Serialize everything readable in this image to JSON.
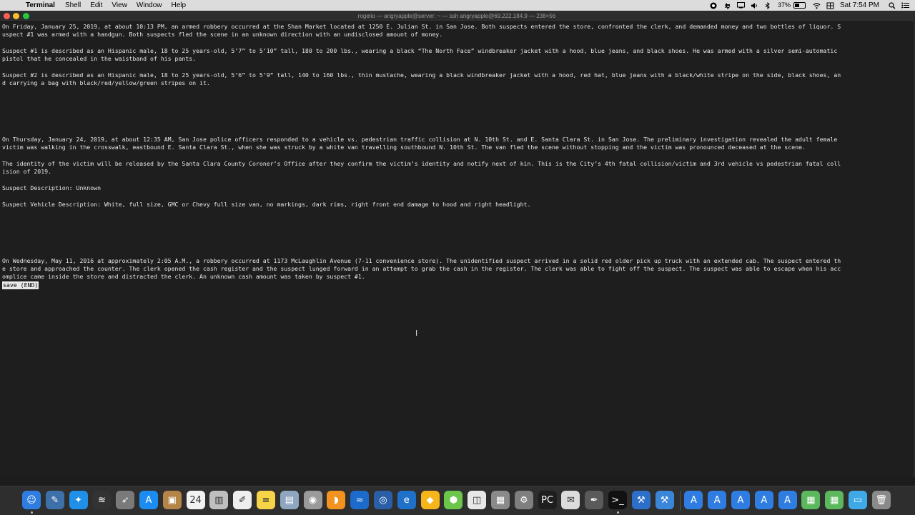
{
  "menubar": {
    "apple_glyph": "",
    "items": [
      "Terminal",
      "Shell",
      "Edit",
      "View",
      "Window",
      "Help"
    ],
    "battery_text": "37%",
    "clock": "Sat 7:54 PM"
  },
  "window": {
    "title": "rogelio — angryapple@server: ~ — ssh angryapple@69.222.184.9 — 238×56"
  },
  "terminal": {
    "lines": [
      "On Friday, January 25, 2019, at about 10:13 PM, an armed robbery occurred at the Shan Market located at 1250 E. Julian St. in San Jose. Both suspects entered the store, confronted the clerk, and demanded money and two bottles of liquor. S",
      "uspect #1 was armed with a handgun. Both suspects fled the scene in an unknown direction with an undisclosed amount of money.",
      "",
      "Suspect #1 is described as an Hispanic male, 18 to 25 years-old, 5’7” to 5’10” tall, 180 to 200 lbs., wearing a black “The North Face” windbreaker jacket with a hood, blue jeans, and black shoes. He was armed with a silver semi-automatic",
      "pistol that he concealed in the waistband of his pants.",
      "",
      "Suspect #2 is described as an Hispanic male, 18 to 25 years-old, 5’6” to 5’9” tall, 140 to 160 lbs., thin mustache, wearing a black windbreaker jacket with a hood, red hat, blue jeans with a black/white stripe on the side, black shoes, an",
      "d carrying a bag with black/red/yellow/green stripes on it.",
      "",
      "",
      "",
      "",
      "",
      "",
      "On Thursday, January 24, 2019, at about 12:35 AM, San Jose police officers responded to a vehicle vs. pedestrian traffic collision at N. 10th St. and E. Santa Clara St. in San Jose. The preliminary investigation revealed the adult female",
      "victim was walking in the crosswalk, eastbound E. Santa Clara St., when she was struck by a white van travelling southbound N. 10th St. The van fled the scene without stopping and the victim was pronounced deceased at the scene.",
      "",
      "The identity of the victim will be released by the Santa Clara County Coroner’s Office after they confirm the victim’s identity and notify next of kin. This is the City’s 4th fatal collision/victim and 3rd vehicle vs pedestrian fatal coll",
      "ision of 2019.",
      "",
      "Suspect Description: Unknown",
      "",
      "Suspect Vehicle Description: White, full size, GMC or Chevy full size van, no markings, dark rims, right front end damage to hood and right headlight.",
      "",
      "",
      "",
      "",
      "",
      "",
      "On Wednesday, May 11, 2016 at approximately 2:05 A.M., a robbery occurred at 1173 McLaughlin Avenue (7-11 convenience store). The unidentified suspect arrived in a solid red older pick up truck with an extended cab. The suspect entered th",
      "e store and approached the counter. The clerk opened the cash register and the suspect lunged forward in an attempt to grab the cash in the register. The clerk was able to fight off the suspect. The suspect was able to escape when his acc",
      "omplice came inside the store and distracted the clerk. An unknown cash amount was taken by suspect #1."
    ],
    "pager_prompt": "save (END)"
  },
  "cursor_glyph": "I",
  "dock": {
    "icons": [
      {
        "name": "finder-icon",
        "glyph": "☺",
        "color": "#2f7de1"
      },
      {
        "name": "preview-icon",
        "glyph": "✎",
        "color": "#3d6fa8"
      },
      {
        "name": "safari-icon",
        "glyph": "✦",
        "color": "#1f8fe8"
      },
      {
        "name": "activity-monitor-icon",
        "glyph": "≋",
        "color": "#333333"
      },
      {
        "name": "launchpad-icon",
        "glyph": "➶",
        "color": "#7a7a7a"
      },
      {
        "name": "app-store-icon",
        "glyph": "A",
        "color": "#1b8cf2"
      },
      {
        "name": "contacts-icon",
        "glyph": "▣",
        "color": "#b58547"
      },
      {
        "name": "calendar-icon",
        "glyph": "24",
        "color": "#f2f2f2"
      },
      {
        "name": "keynote-icon",
        "glyph": "▥",
        "color": "#bfbfbf"
      },
      {
        "name": "textedit-icon",
        "glyph": "✐",
        "color": "#eeeeee"
      },
      {
        "name": "notes-icon",
        "glyph": "≡",
        "color": "#f5d547"
      },
      {
        "name": "photos-viewer-icon",
        "glyph": "▤",
        "color": "#8fa6c0"
      },
      {
        "name": "disk-utility-icon",
        "glyph": "◉",
        "color": "#9a9a9a"
      },
      {
        "name": "books-icon",
        "glyph": "◗",
        "color": "#f2921f"
      },
      {
        "name": "filezilla-icon",
        "glyph": "≈",
        "color": "#1c6ac9"
      },
      {
        "name": "quicktime-icon",
        "glyph": "◎",
        "color": "#2a5fa8"
      },
      {
        "name": "edge-icon",
        "glyph": "e",
        "color": "#1f70c9"
      },
      {
        "name": "sketch-icon",
        "glyph": "◆",
        "color": "#f7b51c"
      },
      {
        "name": "cube-app-icon",
        "glyph": "⬢",
        "color": "#6bc64a"
      },
      {
        "name": "screenshot-icon",
        "glyph": "◫",
        "color": "#e8e8e8"
      },
      {
        "name": "archive-utility-icon",
        "glyph": "▦",
        "color": "#8a8a8a"
      },
      {
        "name": "system-preferences-icon",
        "glyph": "⚙",
        "color": "#7f7f7f"
      },
      {
        "name": "pycharm-icon",
        "glyph": "PC",
        "color": "#1e1e1e"
      },
      {
        "name": "script-editor-icon",
        "glyph": "✉",
        "color": "#dcdcdc"
      },
      {
        "name": "pen-tool-icon",
        "glyph": "✒",
        "color": "#5a5a5a"
      },
      {
        "name": "terminal-icon",
        "glyph": ">_",
        "color": "#111111"
      },
      {
        "name": "xcode-icon",
        "glyph": "⚒",
        "color": "#2b6fc9"
      },
      {
        "name": "instruments-icon",
        "glyph": "⚒",
        "color": "#3a86d9"
      },
      {
        "name": "document-1-icon",
        "glyph": "A",
        "color": "#2f7de1"
      },
      {
        "name": "document-2-icon",
        "glyph": "A",
        "color": "#2f7de1"
      },
      {
        "name": "document-3-icon",
        "glyph": "A",
        "color": "#2f7de1"
      },
      {
        "name": "document-4-icon",
        "glyph": "A",
        "color": "#2f7de1"
      },
      {
        "name": "document-5-icon",
        "glyph": "A",
        "color": "#2f7de1"
      },
      {
        "name": "spreadsheet-1-icon",
        "glyph": "▦",
        "color": "#5cb85c"
      },
      {
        "name": "spreadsheet-2-icon",
        "glyph": "▦",
        "color": "#5cb85c"
      },
      {
        "name": "downloads-folder-icon",
        "glyph": "▭",
        "color": "#3fa9e8"
      },
      {
        "name": "trash-icon",
        "glyph": "🗑",
        "color": "#8a8a8a"
      }
    ]
  }
}
